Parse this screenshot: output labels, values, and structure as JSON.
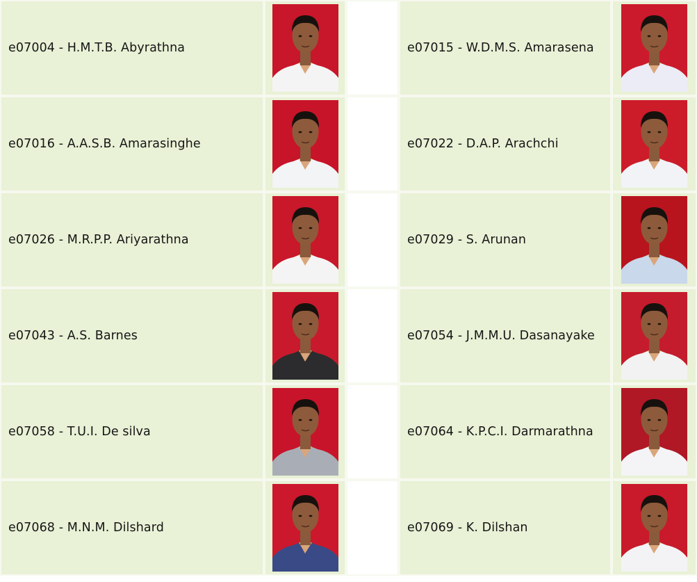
{
  "students": [
    {
      "left": {
        "label": "e07004 - H.M.T.B. Abyrathna",
        "shirt": "#f4f4f4",
        "bg": "#c8162a"
      },
      "right": {
        "label": "e07015 - W.D.M.S. Amarasena",
        "shirt": "#ececf6",
        "bg": "#cb1a2c"
      }
    },
    {
      "left": {
        "label": "e07016 - A.A.S.B. Amarasinghe",
        "shirt": "#f2f4f6",
        "bg": "#c81428"
      },
      "right": {
        "label": "e07022 - D.A.P. Arachchi",
        "shirt": "#f1f3f7",
        "bg": "#cc1c2a"
      }
    },
    {
      "left": {
        "label": "e07026 - M.R.P.P. Ariyarathna",
        "shirt": "#f4f4f4",
        "bg": "#c8182a"
      },
      "right": {
        "label": "e07029 - S. Arunan",
        "shirt": "#c9d8ea",
        "bg": "#b8141e"
      }
    },
    {
      "left": {
        "label": "e07043 - A.S. Barnes",
        "shirt": "#2c2c2e",
        "bg": "#c81a2c"
      },
      "right": {
        "label": "e07054 - J.M.M.U. Dasanayake",
        "shirt": "#f2f2f2",
        "bg": "#c41c2c"
      }
    },
    {
      "left": {
        "label": "e07058 - T.U.I. De silva",
        "shirt": "#a9aeb6",
        "bg": "#c8142a"
      },
      "right": {
        "label": "e07064 - K.P.C.I. Darmarathna",
        "shirt": "#f4f4f6",
        "bg": "#b01826"
      }
    },
    {
      "left": {
        "label": "e07068 - M.N.M. Dilshard",
        "shirt": "#3a4a86",
        "bg": "#cc182c"
      },
      "right": {
        "label": "e07069 - K. Dilshan",
        "shirt": "#f3f3f5",
        "bg": "#c81a2a"
      }
    }
  ]
}
